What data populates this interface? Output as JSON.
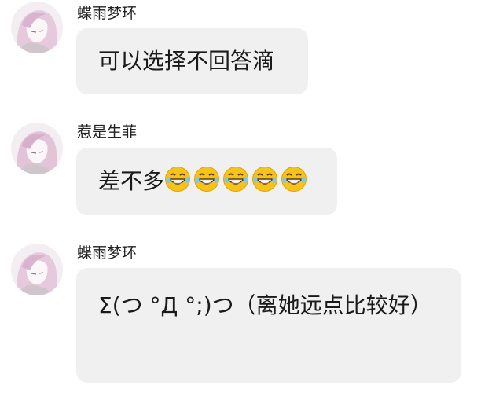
{
  "messages": [
    {
      "sender": "蝶雨梦环",
      "text": "可以选择不回答滴",
      "avatar_icon": "anime-girl-avatar-icon",
      "emoji": []
    },
    {
      "sender": "惹是生菲",
      "text": "差不多",
      "avatar_icon": "anime-girl-avatar-icon",
      "emoji": [
        "laughing-tears-emoji",
        "laughing-tears-emoji",
        "laughing-tears-emoji",
        "laughing-tears-emoji",
        "laughing-tears-emoji"
      ]
    },
    {
      "sender": "蝶雨梦环",
      "text": "Σ(つ °Д °;)つ（离她远点比较好）",
      "avatar_icon": "anime-girl-avatar-icon",
      "emoji": []
    }
  ],
  "colors": {
    "background": "#ffffff",
    "bubble": "#f0f0f0",
    "text": "#1a1a1a",
    "emoji_face": "#f7c21a"
  }
}
